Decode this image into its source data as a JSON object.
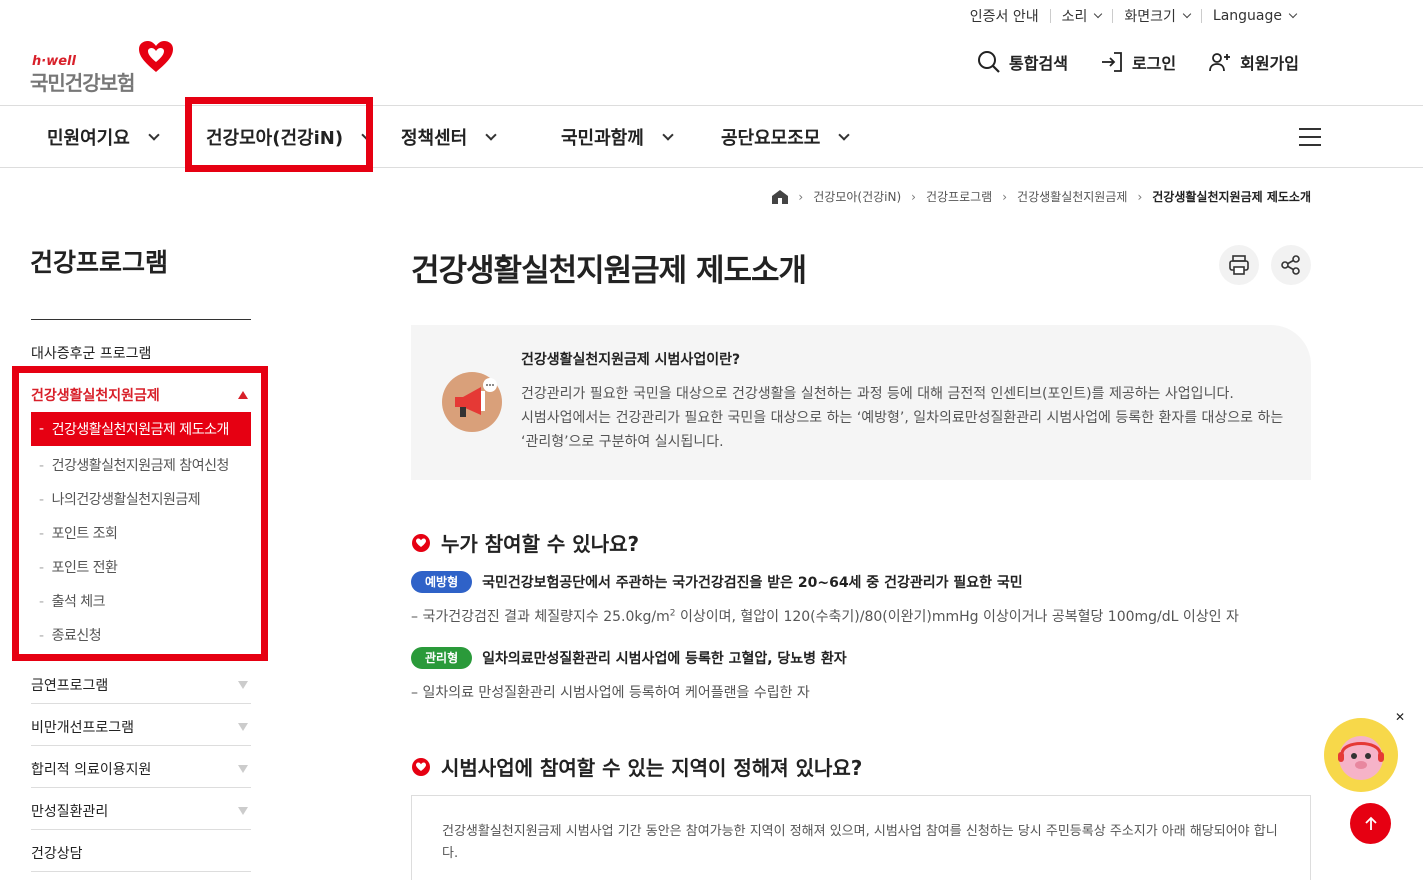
{
  "utility": {
    "cert": "인증서 안내",
    "sound": "소리",
    "screen_size": "화면크기",
    "language": "Language"
  },
  "logo": {
    "tagline": "h·well",
    "name": "국민건강보험"
  },
  "actions": {
    "search": "통합검색",
    "login": "로그인",
    "signup": "회원가입"
  },
  "gnb": {
    "items": [
      "민원여기요",
      "건강모아(건강iN)",
      "정책센터",
      "국민과함께",
      "공단요모조모"
    ]
  },
  "breadcrumb": {
    "items": [
      "건강모아(건강iN)",
      "건강프로그램",
      "건강생활실천지원금제",
      "건강생활실천지원금제 제도소개"
    ]
  },
  "sidebar": {
    "title": "건강프로그램",
    "item_metabolic": "대사증후군 프로그램",
    "active_group": "건강생활실천지원금제",
    "sub_active": "건강생활실천지원금제 제도소개",
    "subs": [
      "건강생활실천지원금제 참여신청",
      "나의건강생활실천지원금제",
      "포인트 조회",
      "포인트 전환",
      "출석 체크",
      "종료신청"
    ],
    "items_after": [
      "금연프로그램",
      "비만개선프로그램",
      "합리적 의료이용지원",
      "만성질환관리",
      "건강상담"
    ]
  },
  "main": {
    "title": "건강생활실천지원금제 제도소개",
    "intro_heading": "건강생활실천지원금제 시범사업이란?",
    "intro_lines": [
      "건강관리가 필요한 국민을 대상으로 건강생활을 실천하는 과정 등에 대해 금전적 인센티브(포인트)를 제공하는 사업입니다.",
      "시범사업에서는 건강관리가 필요한 국민을 대상으로 하는 ‘예방형’, 일차의료만성질환관리 시범사업에 등록한 환자를 대상으로 하는",
      "‘관리형’으로 구분하여 실시됩니다."
    ],
    "section1_title": "누가 참여할 수 있나요?",
    "badge1": "예방형",
    "badge1_text": "국민건강보험공단에서 주관하는 국가건강검진을 받은 20~64세 중 건강관리가 필요한 국민",
    "note1_pre": "– 국가건강검진 결과 체질량지수 25.0kg/m",
    "note1_sup": "2",
    "note1_post": " 이상이며, 혈압이 120(수축기)/80(이완기)mmHg 이상이거나 공복혈당 100mg/dL 이상인 자",
    "badge2": "관리형",
    "badge2_text": "일차의료만성질환관리 시범사업에 등록한 고혈압, 당뇨병 환자",
    "note2": "– 일차의료 만성질환관리 시범사업에 등록하여 케어플랜을 수립한 자",
    "section2_title": "시범사업에 참여할 수 있는 지역이 정해져 있나요?",
    "region_text": "건강생활실천지원금제 시범사업 기간 동안은 참여가능한 지역이 정해져 있으며, 시범사업 참여를 신청하는 당시 주민등록상 주소지가 아래 해당되어야 합니다."
  },
  "colors": {
    "brand_red": "#e60012",
    "badge_blue": "#2f62c8",
    "badge_green": "#2a9a3a"
  }
}
